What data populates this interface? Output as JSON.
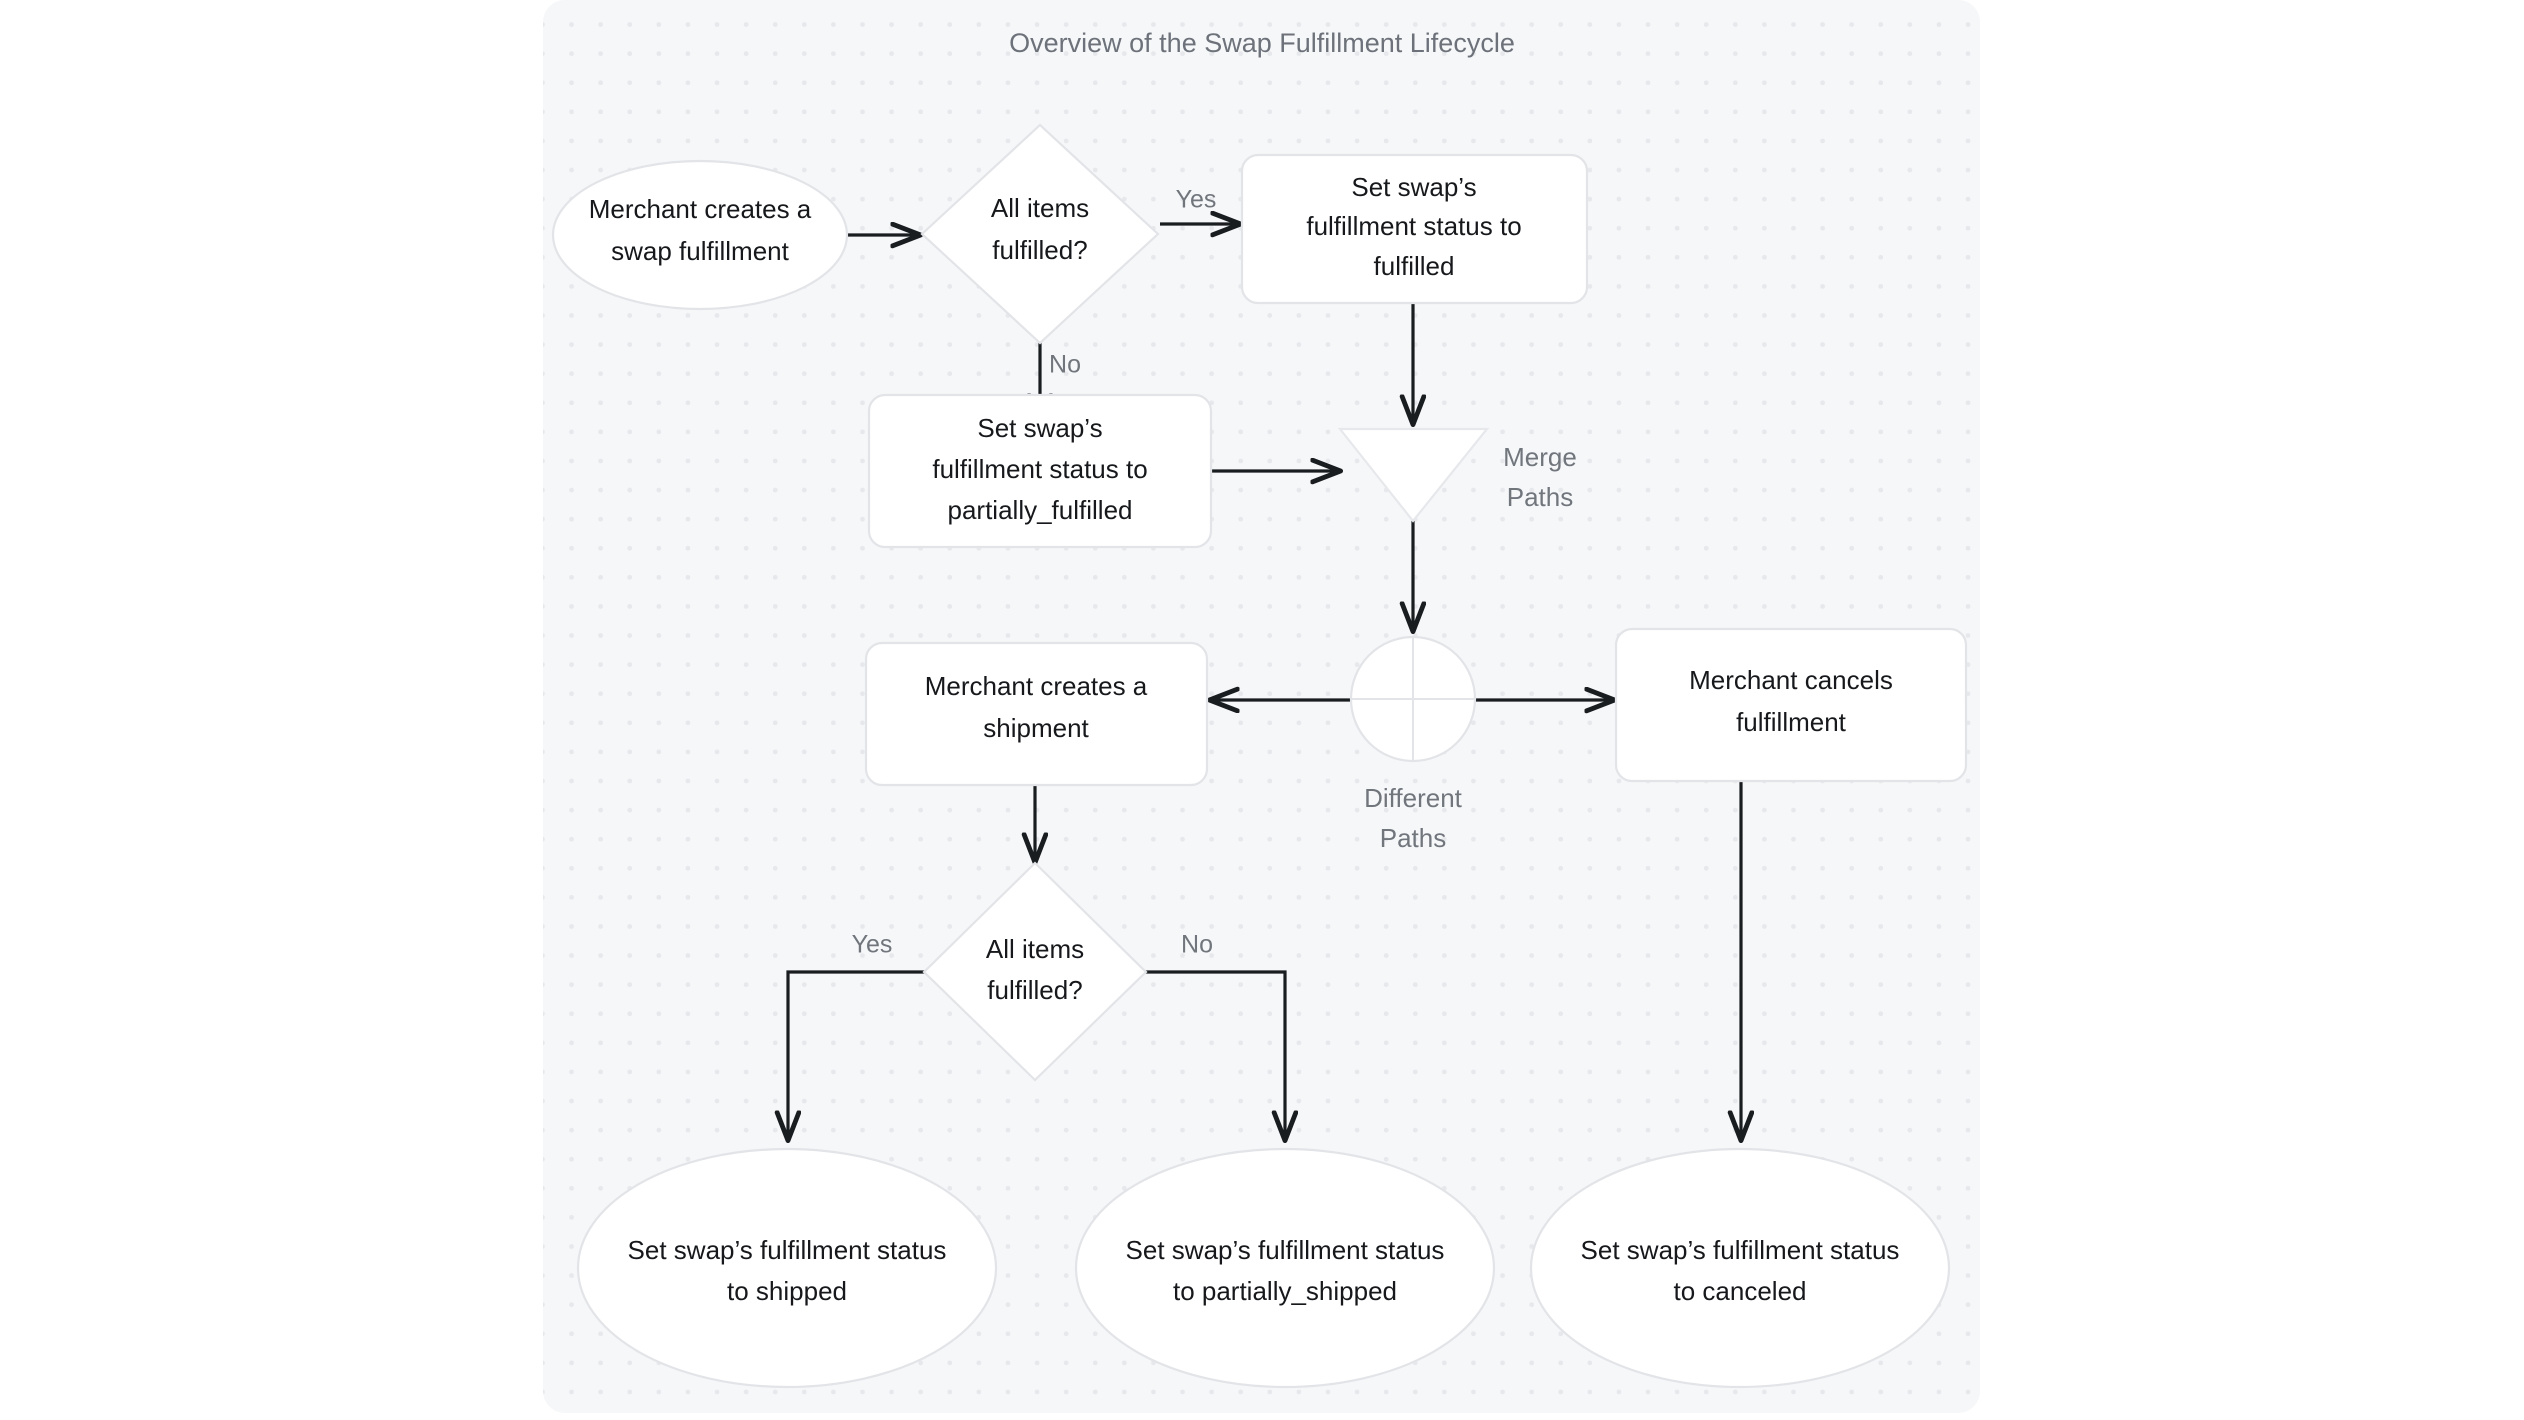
{
  "diagram": {
    "title": "Overview of the Swap Fulfillment Lifecycle",
    "type": "flowchart",
    "orientation": "top-down",
    "canvas": {
      "background_color": "#f6f7f9",
      "grid": "dotted",
      "grid_dot_color": "#e6e8eb",
      "page_background": "#ffffff"
    },
    "colors": {
      "node_fill": "#ffffff",
      "node_border": "#e2e4e7",
      "node_text": "#16181b",
      "edge": "#1a1d20",
      "edge_label_text": "#71767d",
      "title_text": "#6d727a"
    },
    "nodes": [
      {
        "id": "start",
        "shape": "ellipse",
        "lines": [
          "Merchant creates a",
          "swap fulfillment"
        ],
        "text": "Merchant creates a swap fulfillment"
      },
      {
        "id": "decision1",
        "shape": "diamond",
        "lines": [
          "All items",
          "fulfilled?"
        ],
        "text": "All items fulfilled?"
      },
      {
        "id": "set_fulfilled",
        "shape": "rounded-rect",
        "lines": [
          "Set swap’s",
          "fulfillment status to",
          "fulfilled"
        ],
        "text": "Set swap’s fulfillment status to fulfilled"
      },
      {
        "id": "set_partially_fulfilled",
        "shape": "rounded-rect",
        "lines": [
          "Set swap’s",
          "fulfillment status to",
          "partially_fulfilled"
        ],
        "text": "Set swap’s fulfillment status to partially_fulfilled"
      },
      {
        "id": "merge",
        "shape": "inverted-triangle",
        "lines": [
          "Merge",
          "Paths"
        ],
        "text": "Merge Paths",
        "label_position": "right"
      },
      {
        "id": "fork",
        "shape": "circle-cross",
        "lines": [
          "Different",
          "Paths"
        ],
        "text": "Different Paths",
        "label_position": "below"
      },
      {
        "id": "create_shipment",
        "shape": "rounded-rect",
        "lines": [
          "Merchant creates a",
          "shipment"
        ],
        "text": "Merchant creates a shipment"
      },
      {
        "id": "cancel_fulfillment",
        "shape": "rounded-rect",
        "lines": [
          "Merchant cancels",
          "fulfillment"
        ],
        "text": "Merchant cancels fulfillment"
      },
      {
        "id": "decision2",
        "shape": "diamond",
        "lines": [
          "All items",
          "fulfilled?"
        ],
        "text": "All items fulfilled?"
      },
      {
        "id": "set_shipped",
        "shape": "ellipse",
        "lines": [
          "Set swap’s fulfillment status",
          "to shipped"
        ],
        "text": "Set swap’s fulfillment status to shipped"
      },
      {
        "id": "set_partially_shipped",
        "shape": "ellipse",
        "lines": [
          "Set swap’s fulfillment status",
          "to partially_shipped"
        ],
        "text": "Set swap’s fulfillment status to partially_shipped"
      },
      {
        "id": "set_canceled",
        "shape": "ellipse",
        "lines": [
          "Set swap’s fulfillment status",
          "to canceled"
        ],
        "text": "Set swap’s fulfillment status to canceled"
      }
    ],
    "edges": [
      {
        "id": "e1",
        "from": "start",
        "to": "decision1",
        "label": ""
      },
      {
        "id": "e2",
        "from": "decision1",
        "to": "set_fulfilled",
        "label": "Yes"
      },
      {
        "id": "e3",
        "from": "decision1",
        "to": "set_partially_fulfilled",
        "label": "No"
      },
      {
        "id": "e4",
        "from": "set_fulfilled",
        "to": "merge",
        "label": ""
      },
      {
        "id": "e5",
        "from": "set_partially_fulfilled",
        "to": "merge",
        "label": ""
      },
      {
        "id": "e6",
        "from": "merge",
        "to": "fork",
        "label": ""
      },
      {
        "id": "e7",
        "from": "fork",
        "to": "create_shipment",
        "label": ""
      },
      {
        "id": "e8",
        "from": "fork",
        "to": "cancel_fulfillment",
        "label": ""
      },
      {
        "id": "e9",
        "from": "create_shipment",
        "to": "decision2",
        "label": ""
      },
      {
        "id": "e10",
        "from": "decision2",
        "to": "set_shipped",
        "label": "Yes"
      },
      {
        "id": "e11",
        "from": "decision2",
        "to": "set_partially_shipped",
        "label": "No"
      },
      {
        "id": "e12",
        "from": "cancel_fulfillment",
        "to": "set_canceled",
        "label": ""
      }
    ],
    "edge_labels": {
      "yes_top": "Yes",
      "no_top": "No",
      "yes_bottom": "Yes",
      "no_bottom": "No"
    }
  }
}
